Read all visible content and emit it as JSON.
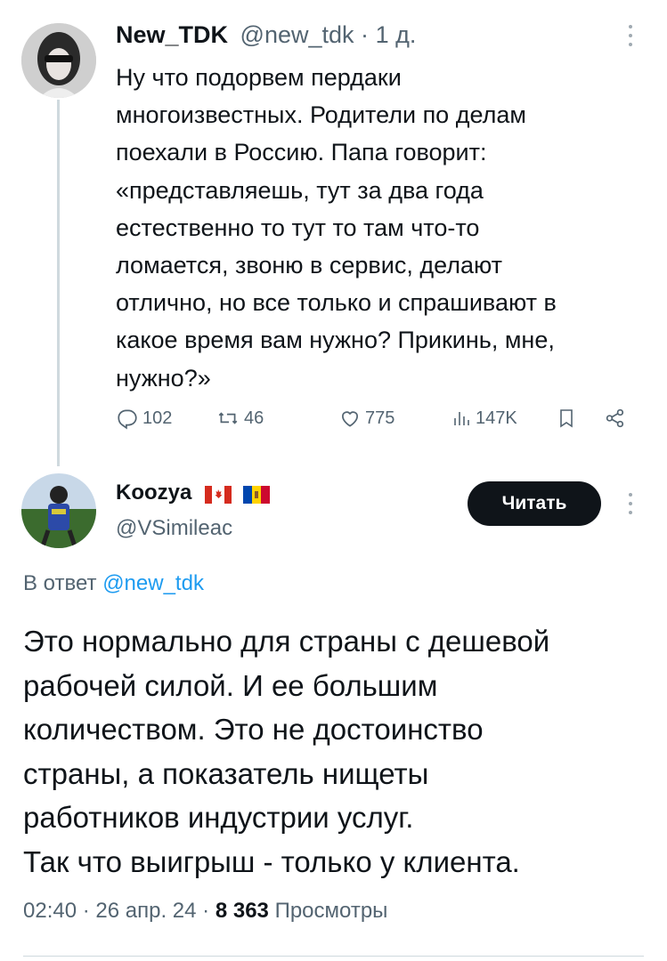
{
  "tweet1": {
    "display_name": "New_TDK",
    "handle": "@new_tdk",
    "separator": "·",
    "time": "1 д.",
    "lines": [
      "Ну что подорвем пердаки",
      "многоизвестных. Родители по делам",
      "поехали в Россию. Папа говорит:",
      "«представляешь, тут за два года",
      "естественно то тут то там что-то",
      "ломается, звоню в сервис, делают",
      "отлично, но все только и спрашивают в",
      "какое время вам нужно? Прикинь, мне,",
      "нужно?»"
    ],
    "actions": {
      "replies": "102",
      "retweets": "46",
      "likes": "775",
      "views": "147K"
    }
  },
  "tweet2": {
    "display_name": "Koozya",
    "handle": "@VSimileac",
    "follow_label": "Читать",
    "reply_prefix": "В ответ",
    "reply_to": "@new_tdk",
    "lines": [
      "Это нормально для страны с дешевой",
      "рабочей силой. И ее большим",
      "количеством. Это не достоинство",
      "страны, а показатель нищеты",
      "работников индустрии услуг.",
      "Так что выигрыш - только у клиента."
    ],
    "time": "02:40",
    "dot1": "·",
    "date": "26 апр. 24",
    "dot2": "·",
    "views_count": "8 363",
    "views_label": "Просмотры",
    "flags": [
      "canada-flag",
      "moldova-flag"
    ]
  },
  "colors": {
    "text": "#0f1419",
    "secondary": "#536471",
    "thread_line": "#cfd9de",
    "button_bg": "#0f1419"
  }
}
